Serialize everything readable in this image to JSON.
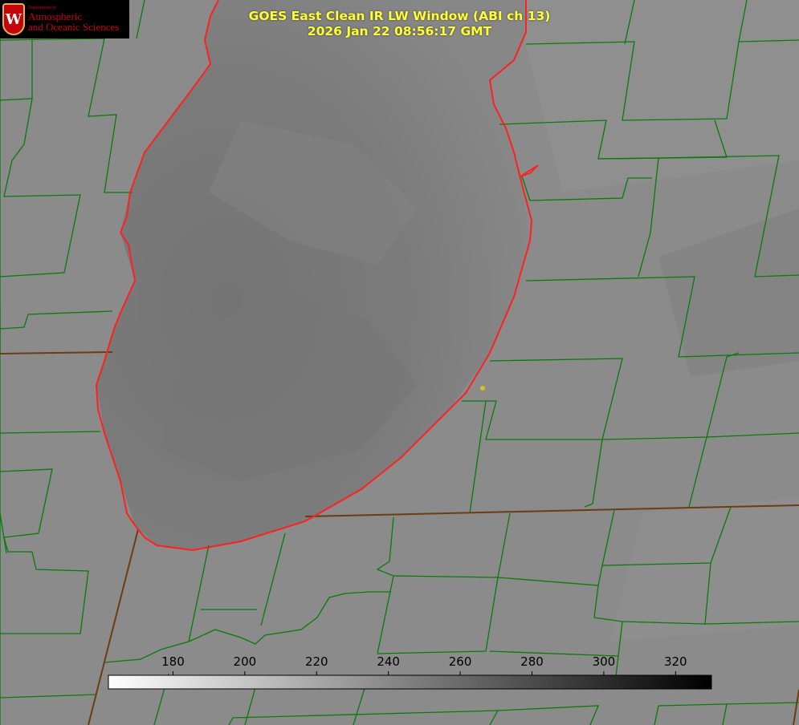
{
  "header": {
    "title_line1": "GOES East Clean IR LW Window (ABI ch 13)",
    "title_line2": "2026 Jan 22 08:56:17 GMT"
  },
  "logo": {
    "department": "Department of",
    "line1": "Atmospheric",
    "line2": "and Oceanic Sciences",
    "seal_letter": "W"
  },
  "colorbar": {
    "ticks": [
      "180",
      "200",
      "220",
      "240",
      "260",
      "280",
      "300",
      "320"
    ],
    "tick_values": [
      180,
      200,
      220,
      240,
      260,
      280,
      300,
      320
    ],
    "value_min": 162,
    "value_max": 330,
    "gradient": [
      "#ffffff",
      "#000000"
    ]
  },
  "colors": {
    "county_lines": "#0a7a0a",
    "shoreline": "#ff2020",
    "state_border": "#7a4a1a",
    "title_text": "#ffff33",
    "marker": "#d4c21a"
  }
}
